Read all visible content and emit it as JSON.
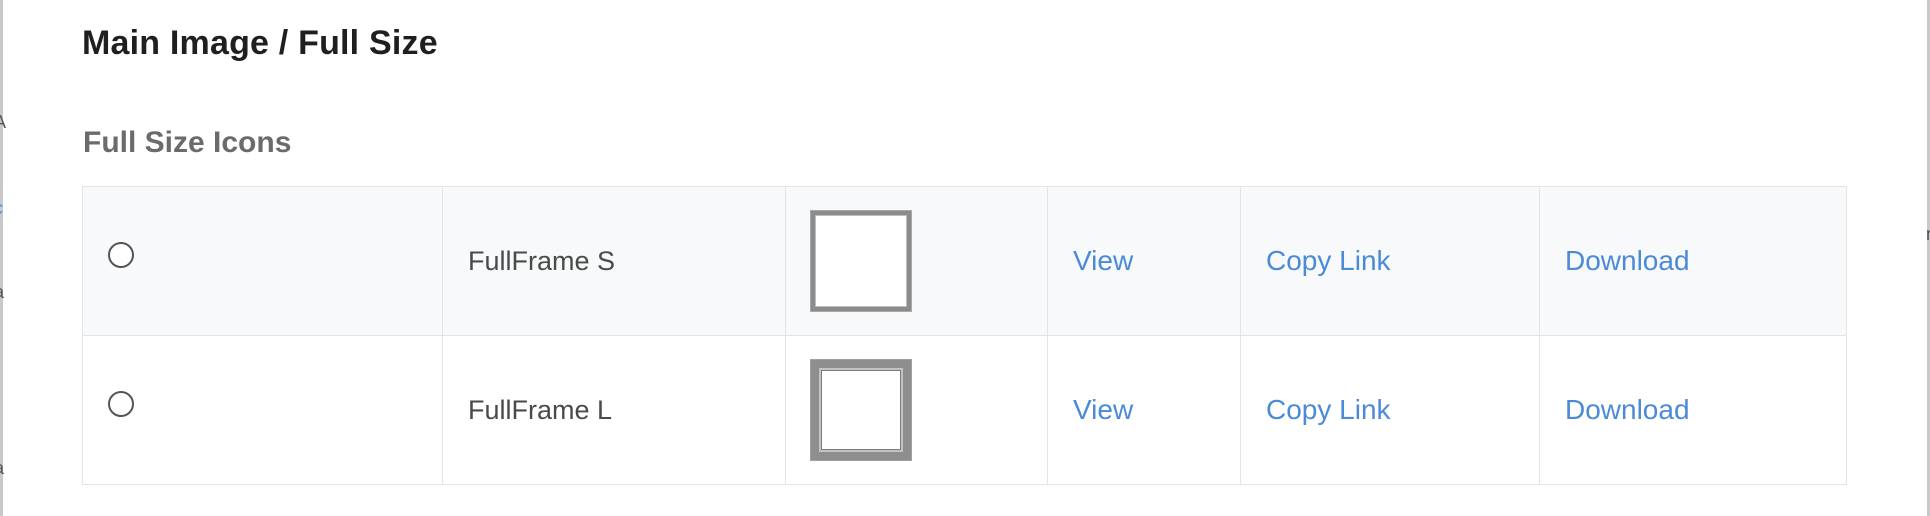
{
  "dialog": {
    "title": "Main Image / Full Size"
  },
  "background_fragments": [
    "A",
    "c",
    "a",
    "a",
    "n"
  ],
  "section": {
    "title": "Full Size Icons"
  },
  "rows": [
    {
      "name": "FullFrame S",
      "thumbnail_icon": "thin-frame-thumbnail",
      "view_label": "View",
      "copy_label": "Copy Link",
      "download_label": "Download",
      "selected": false
    },
    {
      "name": "FullFrame L",
      "thumbnail_icon": "thick-frame-thumbnail",
      "view_label": "View",
      "copy_label": "Copy Link",
      "download_label": "Download",
      "selected": false
    }
  ],
  "colors": {
    "link": "#4a8ad8",
    "row_alt_background": "#f8f9fa",
    "border": "#e2e4e6"
  }
}
